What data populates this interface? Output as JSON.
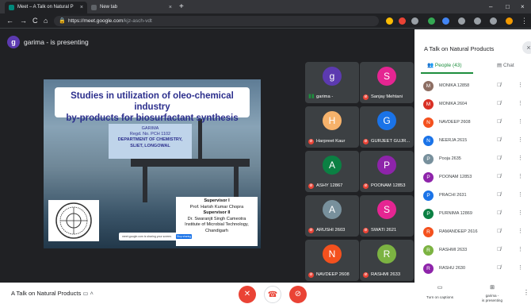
{
  "browser": {
    "tabs": [
      {
        "title": "Meet – A Talk on Natural P",
        "close": "×",
        "favicon_color": "#00897b"
      },
      {
        "title": "New tab",
        "close": "×",
        "favicon_color": "#5f6368"
      }
    ],
    "new_tab": "+",
    "window_controls": {
      "minimize": "–",
      "maximize": "□",
      "close": "×"
    },
    "nav": {
      "back": "←",
      "forward": "→",
      "reload": "C",
      "home": "⌂"
    },
    "url_host": "https://meet.google.com",
    "url_path": "/kjz-asch-vdt"
  },
  "presenter": {
    "initial": "g",
    "text": "garima - is presenting",
    "color": "#5c3ab0"
  },
  "slide": {
    "title_line1": "Studies in utilization of oleo-chemical industry",
    "title_line2": "by-products for biosurfactant synthesis",
    "author": [
      "GARIMA",
      "Regd. No. PCH 1102",
      "DEPARTMENT OF CHEMISTRY,",
      "SLIET, LONGOWAL"
    ],
    "supervisor_1_label": "Supervisor I",
    "supervisor_1_name": "Prof. Harish Kumar Chopra",
    "supervisor_2_label": "Supervisor II",
    "supervisor_2_name": "Dr. Swaranjit Singh Cameotra",
    "supervisor_2_inst": "Institute of Microbial Technology,",
    "supervisor_2_city": "Chandigarh",
    "share_banner": "meet.google.com is sharing your screen.",
    "share_button": "Stop sharing"
  },
  "tiles": [
    {
      "initial": "g",
      "name": "garima -",
      "color": "#5c3ab0",
      "speaking": true
    },
    {
      "initial": "S",
      "name": "Sanjay Mehtani",
      "color": "#e52592",
      "muted": true
    },
    {
      "initial": "H",
      "name": "Harpreet Kaur",
      "color": "#f6b26b",
      "muted": true
    },
    {
      "initial": "G",
      "name": "GURJEET GUJR...",
      "color": "#1a73e8",
      "muted": true
    },
    {
      "initial": "A",
      "name": "ASHY 12867",
      "color": "#0b8043",
      "muted": true
    },
    {
      "initial": "P",
      "name": "POONAM 12853",
      "color": "#8e24aa",
      "muted": true
    },
    {
      "initial": "A",
      "name": "ARUSHI 2603",
      "color": "#78909c",
      "muted": true
    },
    {
      "initial": "S",
      "name": "SWATI 2621",
      "color": "#e52592",
      "muted": true
    },
    {
      "initial": "N",
      "name": "NAVDEEP 2608",
      "color": "#f4511e",
      "muted": true
    },
    {
      "initial": "R",
      "name": "RASHMI 2633",
      "color": "#7cb342",
      "muted": true
    }
  ],
  "panel": {
    "title": "A Talk on Natural Products",
    "close": "×",
    "people_tab": "People (43)",
    "chat_tab": "Chat",
    "mic_icon": "🎙",
    "more_icon": "⋮",
    "participants": [
      {
        "initial": "M",
        "name": "MONIKA 12858",
        "color": "#8d6e63"
      },
      {
        "initial": "M",
        "name": "MONIKA 2604",
        "color": "#d93025"
      },
      {
        "initial": "N",
        "name": "NAVDEEP 2608",
        "color": "#f4511e"
      },
      {
        "initial": "N",
        "name": "NEERJA 2615",
        "color": "#1a73e8"
      },
      {
        "initial": "P",
        "name": "Pooja 2635",
        "color": "#78909c"
      },
      {
        "initial": "P",
        "name": "POONAM 12853",
        "color": "#8e24aa"
      },
      {
        "initial": "P",
        "name": "PRACHI 2631",
        "color": "#1a73e8"
      },
      {
        "initial": "P",
        "name": "PURNIMA 12869",
        "color": "#0b8043"
      },
      {
        "initial": "R",
        "name": "RAMANDEEP 2616",
        "color": "#f4511e"
      },
      {
        "initial": "R",
        "name": "RASHMI 2633",
        "color": "#7cb342"
      },
      {
        "initial": "R",
        "name": "RASHU 2630",
        "color": "#8e24aa"
      }
    ]
  },
  "bottom": {
    "meeting_title": "A Talk on Natural Products",
    "captions_label": "Turn on captions",
    "present_label_1": "garima -",
    "present_label_2": "is presenting",
    "mic_off": "✕",
    "hangup": "☎",
    "cam_off": "⊘"
  }
}
